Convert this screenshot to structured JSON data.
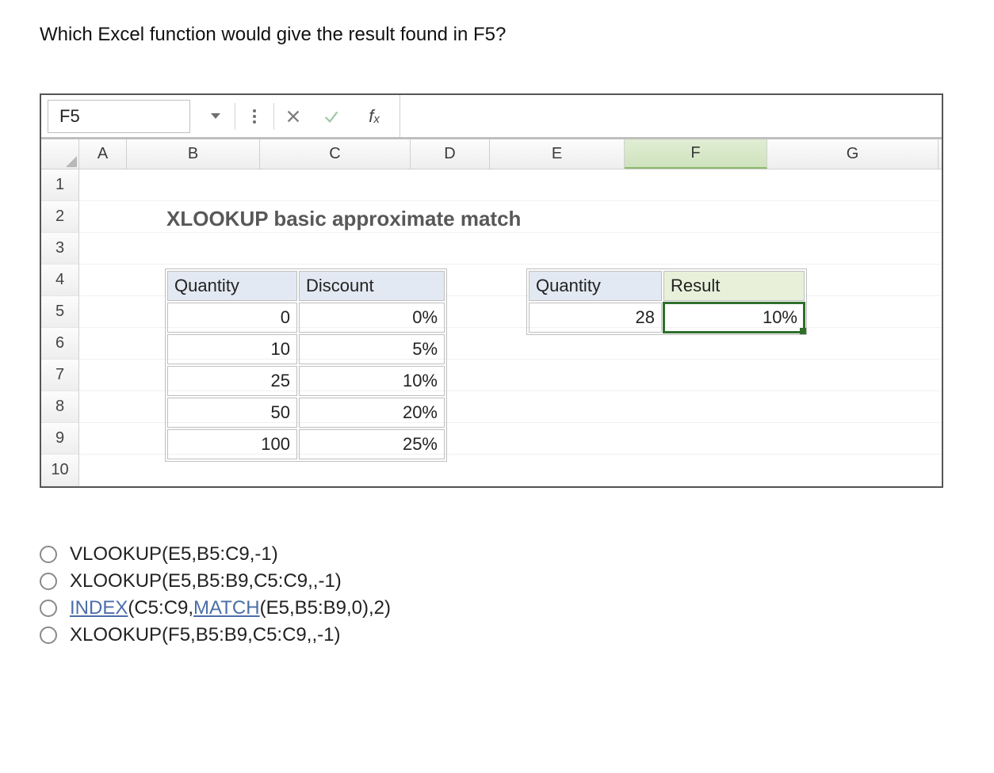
{
  "question": "Which Excel function would give the result found in F5?",
  "name_box": "F5",
  "columns": [
    "A",
    "B",
    "C",
    "D",
    "E",
    "F",
    "G"
  ],
  "selected_column": "F",
  "rows": [
    "1",
    "2",
    "3",
    "4",
    "5",
    "6",
    "7",
    "8",
    "9",
    "10"
  ],
  "title": "XLOOKUP basic approximate match",
  "table1": {
    "headers": [
      "Quantity",
      "Discount"
    ],
    "rows": [
      [
        "0",
        "0%"
      ],
      [
        "10",
        "5%"
      ],
      [
        "25",
        "10%"
      ],
      [
        "50",
        "20%"
      ],
      [
        "100",
        "25%"
      ]
    ]
  },
  "table2": {
    "headers": [
      "Quantity",
      "Result"
    ],
    "row": [
      "28",
      "10%"
    ]
  },
  "answers": {
    "a": "VLOOKUP(E5,B5:C9,-1)",
    "b": "XLOOKUP(E5,B5:B9,C5:C9,,-1)",
    "c_pre": "INDEX",
    "c_mid1": "(C5:C9,",
    "c_link2": "MATCH",
    "c_mid2": "(E5,B5:B9,0),2)",
    "d": "XLOOKUP(F5,B5:B9,C5:C9,,-1)"
  },
  "col_widths": {
    "A": 60,
    "B": 168,
    "C": 190,
    "D": 100,
    "E": 170,
    "F": 180,
    "G": 216
  }
}
